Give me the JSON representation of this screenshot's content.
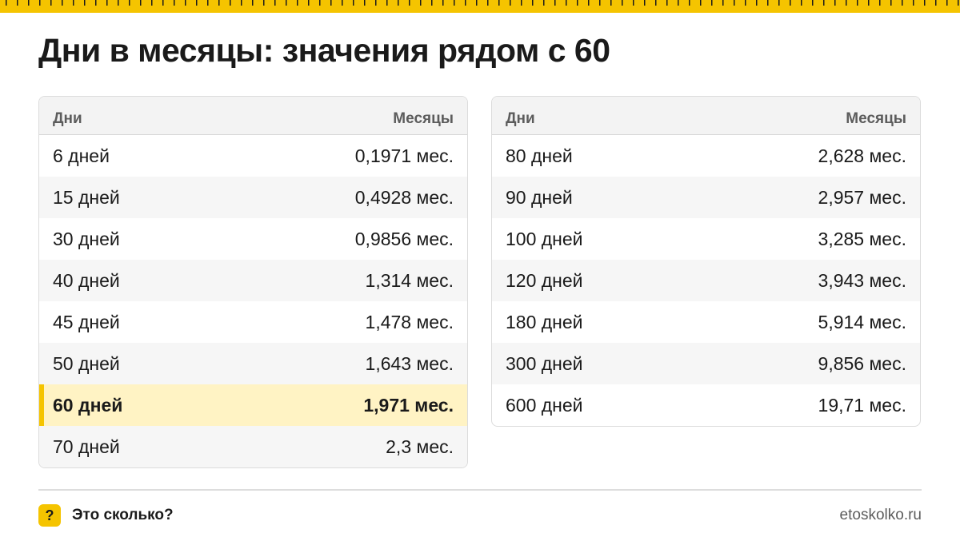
{
  "title": "Дни в месяцы: значения рядом с 60",
  "accent_color": "#f5c400",
  "highlight_color": "#fff3c4",
  "tables": {
    "left": {
      "header": {
        "days": "Дни",
        "months": "Месяцы"
      },
      "rows": [
        {
          "days": "6 дней",
          "months": "0,1971 мес."
        },
        {
          "days": "15 дней",
          "months": "0,4928 мес."
        },
        {
          "days": "30 дней",
          "months": "0,9856 мес."
        },
        {
          "days": "40 дней",
          "months": "1,314 мес."
        },
        {
          "days": "45 дней",
          "months": "1,478 мес."
        },
        {
          "days": "50 дней",
          "months": "1,643 мес."
        },
        {
          "days": "60 дней",
          "months": "1,971 мес.",
          "highlighted": true
        },
        {
          "days": "70 дней",
          "months": "2,3 мес."
        }
      ]
    },
    "right": {
      "header": {
        "days": "Дни",
        "months": "Месяцы"
      },
      "rows": [
        {
          "days": "80 дней",
          "months": "2,628 мес."
        },
        {
          "days": "90 дней",
          "months": "2,957 мес."
        },
        {
          "days": "100 дней",
          "months": "3,285 мес."
        },
        {
          "days": "120 дней",
          "months": "3,943 мес."
        },
        {
          "days": "180 дней",
          "months": "5,914 мес."
        },
        {
          "days": "300 дней",
          "months": "9,856 мес."
        },
        {
          "days": "600 дней",
          "months": "19,71 мес."
        }
      ]
    }
  },
  "footer": {
    "badge": "?",
    "brand": "Это сколько?",
    "site": "etoskolko.ru"
  }
}
